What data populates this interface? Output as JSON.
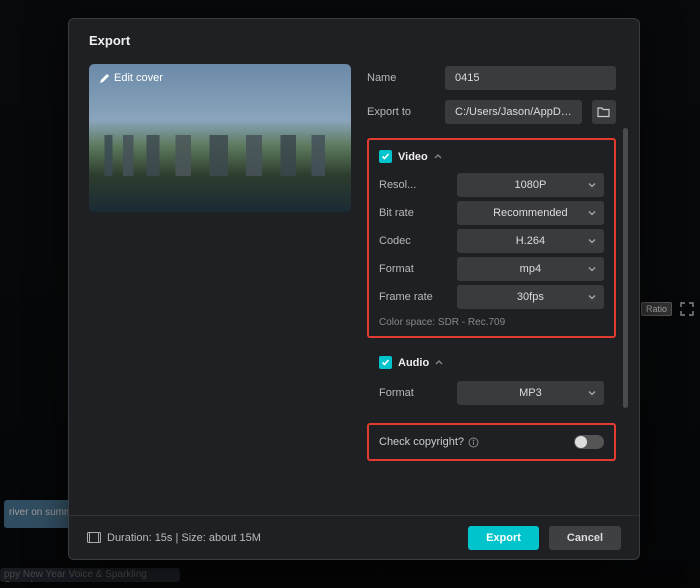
{
  "dialog": {
    "title": "Export",
    "editCoverLabel": "Edit cover"
  },
  "fields": {
    "name": {
      "label": "Name",
      "value": "0415"
    },
    "exportTo": {
      "label": "Export to",
      "value": "C:/Users/Jason/AppD…"
    }
  },
  "video": {
    "sectionTitle": "Video",
    "resolution": {
      "label": "Resol...",
      "value": "1080P"
    },
    "bitrate": {
      "label": "Bit rate",
      "value": "Recommended"
    },
    "codec": {
      "label": "Codec",
      "value": "H.264"
    },
    "format": {
      "label": "Format",
      "value": "mp4"
    },
    "framerate": {
      "label": "Frame rate",
      "value": "30fps"
    },
    "colorspace": "Color space: SDR - Rec.709"
  },
  "audio": {
    "sectionTitle": "Audio",
    "format": {
      "label": "Format",
      "value": "MP3"
    }
  },
  "copyright": {
    "label": "Check copyright?",
    "enabled": false
  },
  "footer": {
    "info": "Duration: 15s | Size: about 15M",
    "exportLabel": "Export",
    "cancelLabel": "Cancel"
  },
  "background": {
    "thumb1": "river on summer",
    "thumb2": "ppy New Year Voice & Sparkling Sound",
    "ratioChip": "Ratio"
  },
  "colors": {
    "accent": "#00c4cc",
    "highlight": "#e33b2f"
  }
}
